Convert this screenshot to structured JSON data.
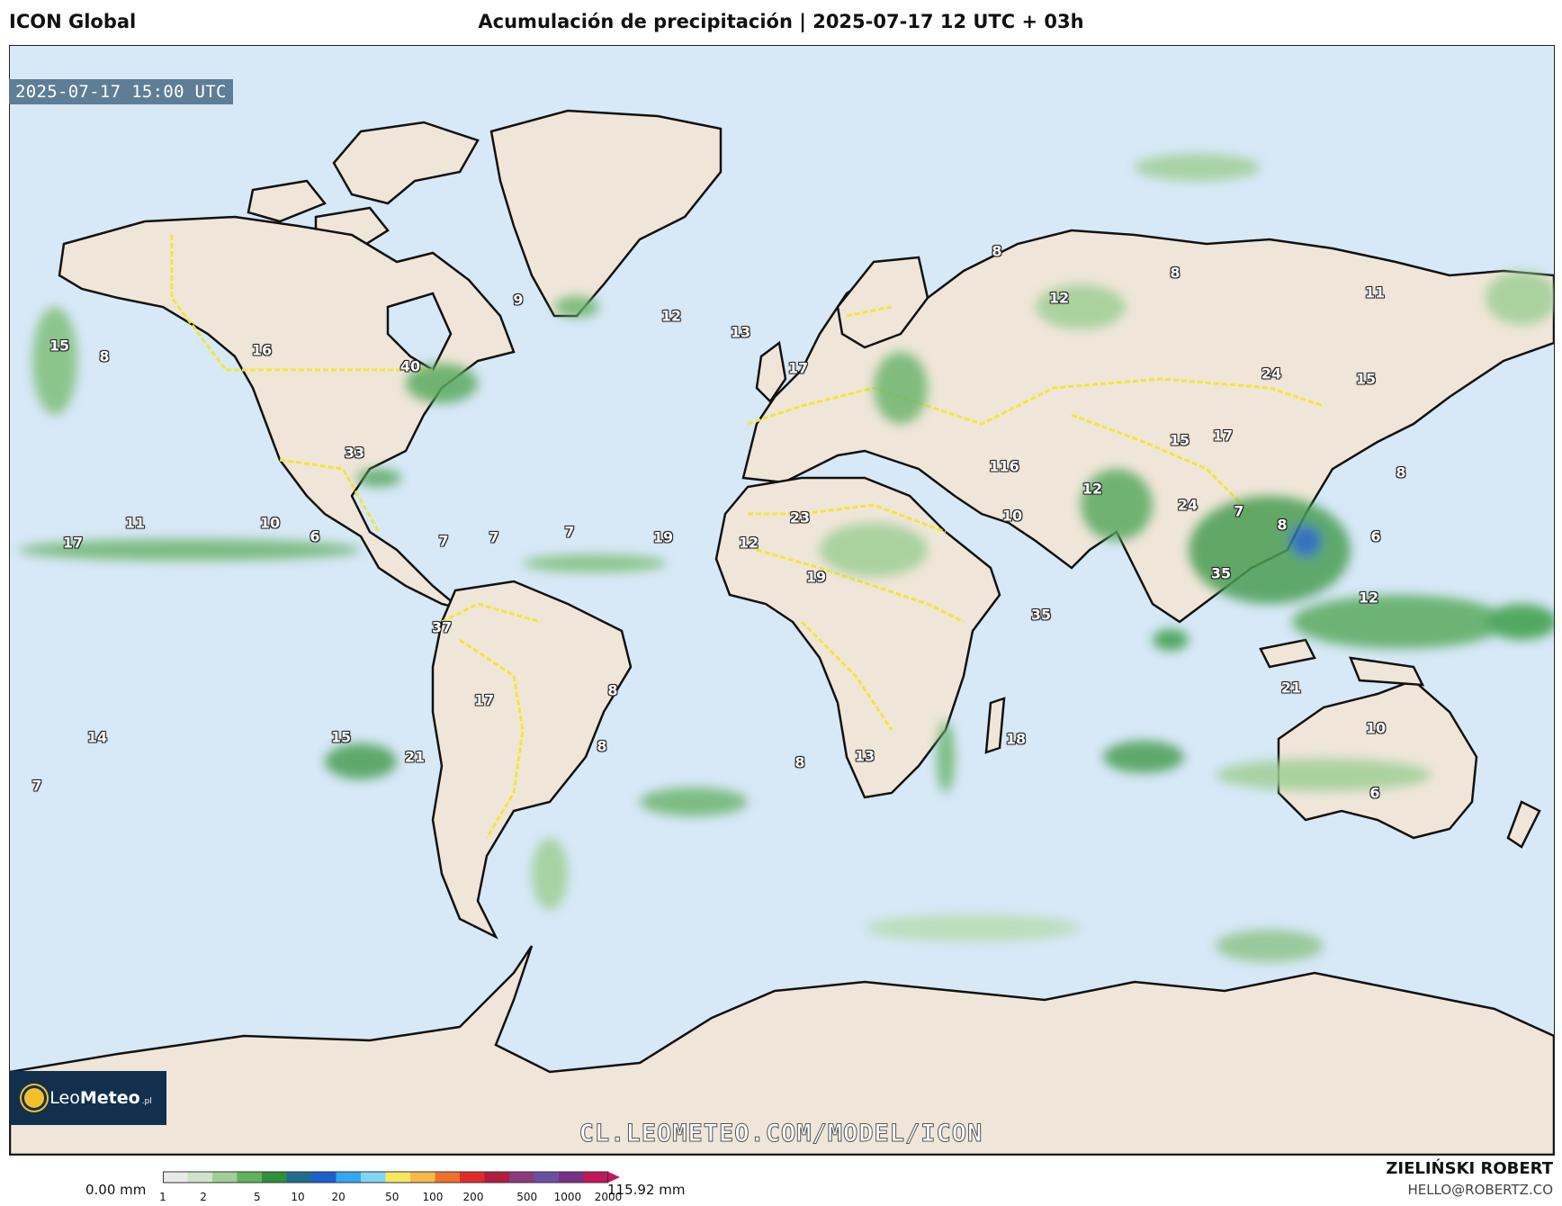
{
  "header": {
    "model": "ICON Global",
    "title": "Acumulación de precipitación | 2025-07-17 12 UTC + 03h"
  },
  "map": {
    "valid_time": "2025-07-17 15:00 UTC",
    "watermark_url": "CL.LEOMETEO.COM/MODEL/ICON",
    "logo": {
      "text_light": "Leo",
      "text_bold": "Meteo",
      "suffix": ".pl"
    },
    "colors": {
      "ocean": "#d7e8f7",
      "land": "#efe6d9",
      "borders": "#f2e635",
      "precip_light": "#a8d0a6",
      "precip_mid": "#3a9e47",
      "precip_high": "#1a5fb4"
    },
    "max_labels": [
      {
        "value": "15"
      },
      {
        "value": "8"
      },
      {
        "value": "16"
      },
      {
        "value": "40"
      },
      {
        "value": "9"
      },
      {
        "value": "12"
      },
      {
        "value": "13"
      },
      {
        "value": "17"
      },
      {
        "value": "8"
      },
      {
        "value": "8"
      },
      {
        "value": "12"
      },
      {
        "value": "11"
      },
      {
        "value": "24"
      },
      {
        "value": "15"
      },
      {
        "value": "33"
      },
      {
        "value": "116"
      },
      {
        "value": "15"
      },
      {
        "value": "17"
      },
      {
        "value": "8"
      },
      {
        "value": "12"
      },
      {
        "value": "24"
      },
      {
        "value": "7"
      },
      {
        "value": "8"
      },
      {
        "value": "10"
      },
      {
        "value": "6"
      },
      {
        "value": "11"
      },
      {
        "value": "10"
      },
      {
        "value": "6"
      },
      {
        "value": "17"
      },
      {
        "value": "7"
      },
      {
        "value": "7"
      },
      {
        "value": "7"
      },
      {
        "value": "19"
      },
      {
        "value": "23"
      },
      {
        "value": "12"
      },
      {
        "value": "19"
      },
      {
        "value": "35"
      },
      {
        "value": "35"
      },
      {
        "value": "12"
      },
      {
        "value": "37"
      },
      {
        "value": "17"
      },
      {
        "value": "8"
      },
      {
        "value": "21"
      },
      {
        "value": "14"
      },
      {
        "value": "15"
      },
      {
        "value": "8"
      },
      {
        "value": "21"
      },
      {
        "value": "8"
      },
      {
        "value": "13"
      },
      {
        "value": "18"
      },
      {
        "value": "10"
      },
      {
        "value": "7"
      },
      {
        "value": "6"
      }
    ]
  },
  "legend": {
    "min_label": "0.00 mm",
    "max_label": "115.92 mm",
    "ticks": [
      "1",
      "2",
      "5",
      "10",
      "20",
      "50",
      "100",
      "200",
      "500",
      "1000",
      "2000"
    ],
    "colors": [
      "#e9e9e9",
      "#cfe3cb",
      "#9fcf95",
      "#5fb35e",
      "#2f8f3b",
      "#1e6e8e",
      "#1f5fd0",
      "#35a6f0",
      "#7fd6f3",
      "#f7e861",
      "#f7b84a",
      "#f0702b",
      "#e02b2b",
      "#b21d3f",
      "#8c3a7e",
      "#6a4fa3",
      "#7a2f86",
      "#c2185b"
    ]
  },
  "credits": {
    "author": "ZIELIŃSKI ROBERT",
    "email": "HELLO@ROBERTZ.CO"
  }
}
